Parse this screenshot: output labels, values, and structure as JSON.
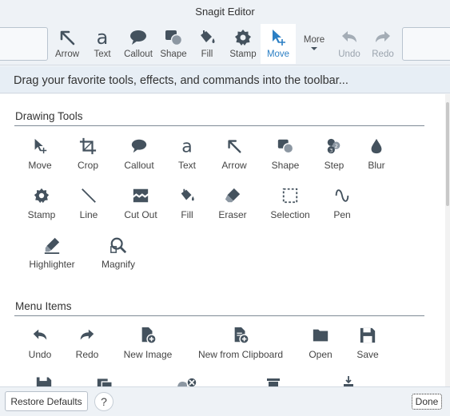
{
  "window": {
    "title": "Snagit Editor"
  },
  "toolbar": {
    "items": [
      {
        "label": "Arrow",
        "icon": "arrow-icon"
      },
      {
        "label": "Text",
        "icon": "text-icon"
      },
      {
        "label": "Callout",
        "icon": "callout-icon"
      },
      {
        "label": "Shape",
        "icon": "shape-icon"
      },
      {
        "label": "Fill",
        "icon": "fill-icon"
      },
      {
        "label": "Stamp",
        "icon": "stamp-icon"
      },
      {
        "label": "Move",
        "icon": "move-icon",
        "active": true
      },
      {
        "label": "More",
        "icon": "chevron-down-icon"
      },
      {
        "label": "Undo",
        "icon": "undo-icon",
        "disabled": true
      },
      {
        "label": "Redo",
        "icon": "redo-icon",
        "disabled": true
      }
    ]
  },
  "hint": "Drag your favorite tools, effects, and commands into the toolbar...",
  "sections": {
    "drawing_title": "Drawing Tools",
    "drawing": [
      {
        "label": "Move",
        "icon": "move-icon"
      },
      {
        "label": "Crop",
        "icon": "crop-icon"
      },
      {
        "label": "Callout",
        "icon": "callout-icon"
      },
      {
        "label": "Text",
        "icon": "text-icon"
      },
      {
        "label": "Arrow",
        "icon": "arrow-icon"
      },
      {
        "label": "Shape",
        "icon": "shape-icon"
      },
      {
        "label": "Step",
        "icon": "step-icon"
      },
      {
        "label": "Blur",
        "icon": "blur-icon"
      },
      {
        "label": "Stamp",
        "icon": "stamp-icon"
      },
      {
        "label": "Line",
        "icon": "line-icon"
      },
      {
        "label": "Cut Out",
        "icon": "cut-out-icon"
      },
      {
        "label": "Fill",
        "icon": "fill-icon"
      },
      {
        "label": "Eraser",
        "icon": "eraser-icon"
      },
      {
        "label": "Selection",
        "icon": "selection-icon"
      },
      {
        "label": "Pen",
        "icon": "pen-icon"
      },
      {
        "label": "Highlighter",
        "icon": "highlighter-icon"
      },
      {
        "label": "Magnify",
        "icon": "magnify-icon"
      }
    ],
    "menu_title": "Menu Items",
    "menu": [
      {
        "label": "Undo",
        "icon": "undo-icon"
      },
      {
        "label": "Redo",
        "icon": "redo-icon"
      },
      {
        "label": "New Image",
        "icon": "new-image-icon"
      },
      {
        "label": "New from Clipboard",
        "icon": "clipboard-icon"
      },
      {
        "label": "Open",
        "icon": "folder-icon"
      },
      {
        "label": "Save",
        "icon": "save-icon"
      }
    ]
  },
  "footer": {
    "restore": "Restore Defaults",
    "help": "?",
    "done": "Done"
  },
  "colors": {
    "icon": "#44525e",
    "accent": "#2b7fc4"
  }
}
